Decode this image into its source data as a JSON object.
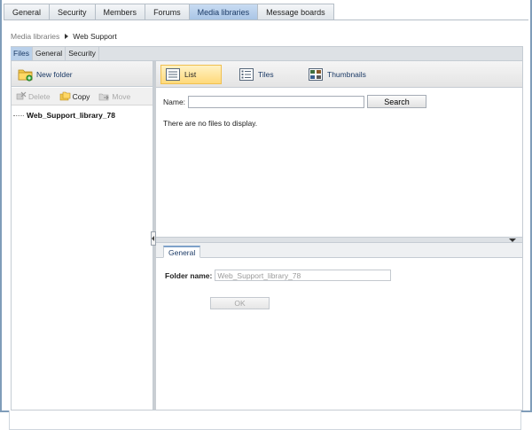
{
  "top_tabs": [
    {
      "label": "General",
      "active": false
    },
    {
      "label": "Security",
      "active": false
    },
    {
      "label": "Members",
      "active": false
    },
    {
      "label": "Forums",
      "active": false
    },
    {
      "label": "Media libraries",
      "active": true
    },
    {
      "label": "Message boards",
      "active": false
    }
  ],
  "breadcrumb": {
    "parent": "Media libraries",
    "current": "Web Support"
  },
  "sub_tabs": [
    {
      "label": "Files",
      "active": true
    },
    {
      "label": "General",
      "active": false
    },
    {
      "label": "Security",
      "active": false
    }
  ],
  "left_toolbar": {
    "new_folder": "New folder",
    "icon": "new-folder-icon"
  },
  "actions": {
    "delete": "Delete",
    "copy": "Copy",
    "move": "Move"
  },
  "tree": {
    "root": "Web_Support_library_78"
  },
  "views": {
    "list": "List",
    "tiles": "Tiles",
    "thumbnails": "Thumbnails",
    "active": "list"
  },
  "search": {
    "name_label": "Name:",
    "name_value": "",
    "button": "Search"
  },
  "empty_message": "There are no files to display.",
  "detail": {
    "tab": "General",
    "folder_label": "Folder name:",
    "folder_value": "Web_Support_library_78",
    "ok": "OK"
  },
  "colors": {
    "active_tab": "#a9c5e6",
    "active_view": "#ffd97a",
    "frame": "#7f9db9"
  }
}
